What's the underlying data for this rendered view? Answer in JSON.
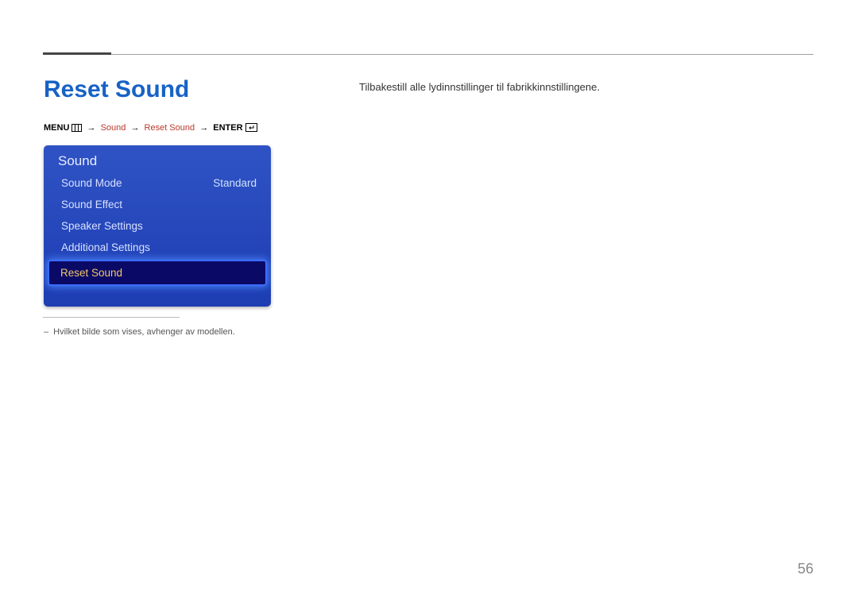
{
  "title": "Reset Sound",
  "description": "Tilbakestill alle lydinnstillinger til fabrikkinnstillingene.",
  "breadcrumb": {
    "menu_label": "MENU",
    "step1": "Sound",
    "step2": "Reset Sound",
    "enter_label": "ENTER"
  },
  "menu": {
    "header": "Sound",
    "items": [
      {
        "label": "Sound Mode",
        "value": "Standard"
      },
      {
        "label": "Sound Effect",
        "value": ""
      },
      {
        "label": "Speaker Settings",
        "value": ""
      },
      {
        "label": "Additional Settings",
        "value": ""
      },
      {
        "label": "Reset Sound",
        "value": ""
      }
    ],
    "highlight_index": 4
  },
  "footnote": "Hvilket bilde som vises, avhenger av modellen.",
  "page_number": "56"
}
